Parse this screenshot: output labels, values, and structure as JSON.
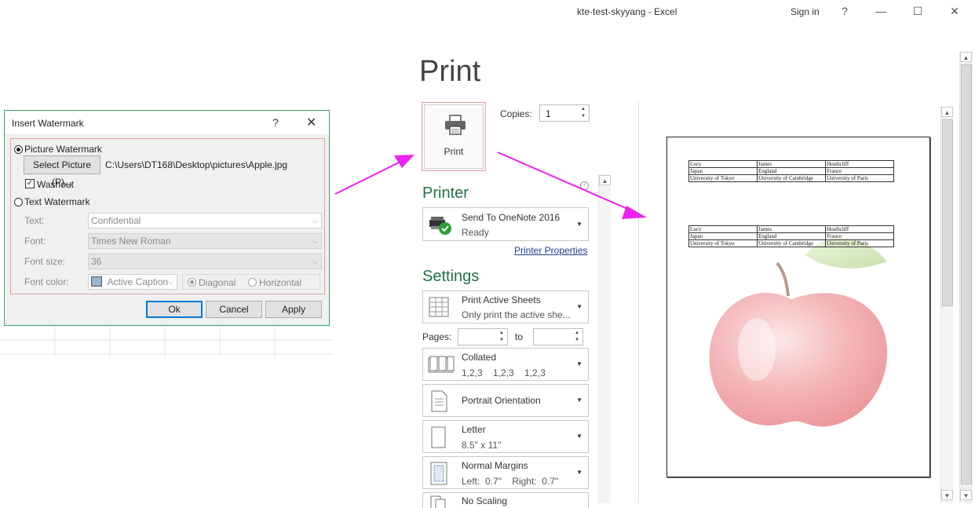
{
  "window": {
    "title": "kte-test-skyyang  -  Excel",
    "sign_in": "Sign in",
    "help": "?",
    "minimize": "—",
    "maximize": "☐",
    "close": "✕"
  },
  "print_view": {
    "heading": "Print",
    "print_button": "Print",
    "copies_label": "Copies:",
    "copies_value": "1",
    "printer_section": "Printer",
    "printer": {
      "name": "Send To OneNote 2016",
      "status": "Ready"
    },
    "printer_properties": "Printer Properties",
    "settings_section": "Settings",
    "settings": [
      {
        "main": "Print Active Sheets",
        "sub": "Only print the active she...",
        "icon": "sheets-icon"
      },
      {
        "main": "Collated",
        "sub": "1,2,3    1,2,3    1,2,3",
        "icon": "collated-icon"
      },
      {
        "main": "Portrait Orientation",
        "sub": "",
        "icon": "portrait-icon"
      },
      {
        "main": "Letter",
        "sub": "8.5\" x 11\"",
        "icon": "letter-icon"
      },
      {
        "main": "Normal Margins",
        "sub": "Left:  0.7\"    Right:  0.7\"",
        "icon": "margins-icon"
      },
      {
        "main": "No Scaling",
        "sub": "",
        "icon": "scaling-icon"
      }
    ],
    "pages_label": "Pages:",
    "to_label": "to"
  },
  "preview": {
    "table1": [
      [
        "Lucy",
        "James",
        "Heathcliff"
      ],
      [
        "Japan",
        "England",
        "France"
      ],
      [
        "University of Tokyo",
        "University of Cambridge",
        "University of Paris"
      ]
    ],
    "table2": [
      [
        "Lucy",
        "James",
        "Heathcliff"
      ],
      [
        "Japan",
        "England",
        "France"
      ],
      [
        "University of Tokyo",
        "University of Cambridge",
        "University of Paris"
      ]
    ]
  },
  "dialog": {
    "title": "Insert Watermark",
    "help": "?",
    "close": "✕",
    "picture_watermark": "Picture Watermark",
    "select_picture": "Select Picture (P)...",
    "picture_path": "C:\\Users\\DT168\\Desktop\\pictures\\Apple.jpg",
    "washout": "Washout",
    "text_watermark": "Text Watermark",
    "text_label": "Text:",
    "text_value": "Confidential",
    "font_label": "Font:",
    "font_value": "Times New Roman",
    "font_size_label": "Font size:",
    "font_size_value": "36",
    "font_color_label": "Font color:",
    "font_color_value": "Active Caption",
    "diagonal": "Diagonal",
    "horizontal": "Horizontal",
    "ok": "Ok",
    "cancel": "Cancel",
    "apply": "Apply"
  },
  "colors": {
    "excel_green": "#217346",
    "arrow": "#ee22ee"
  }
}
